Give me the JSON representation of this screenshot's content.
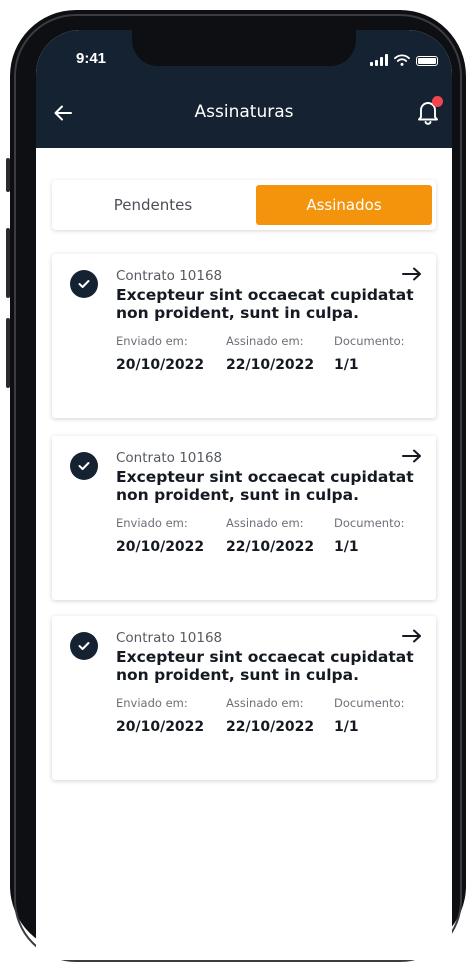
{
  "status_bar": {
    "time": "9:41"
  },
  "header": {
    "title": "Assinaturas",
    "back_icon": "arrow-left-icon",
    "notification_icon": "bell-icon"
  },
  "tabs": [
    {
      "label": "Pendentes",
      "active": false
    },
    {
      "label": "Assinados",
      "active": true
    }
  ],
  "colors": {
    "header_bg": "#152231",
    "accent": "#f4940d",
    "notification_dot": "#f2454d"
  },
  "labels": {
    "sent": "Enviado em:",
    "signed": "Assinado em:",
    "document": "Documento:"
  },
  "contracts": [
    {
      "number": "Contrato 10168",
      "title": "Excepteur sint occaecat cupidatat non proident, sunt in culpa.",
      "sent_date": "20/10/2022",
      "signed_date": "22/10/2022",
      "document": "1/1"
    },
    {
      "number": "Contrato 10168",
      "title": "Excepteur sint occaecat cupidatat non proident, sunt in culpa.",
      "sent_date": "20/10/2022",
      "signed_date": "22/10/2022",
      "document": "1/1"
    },
    {
      "number": "Contrato 10168",
      "title": "Excepteur sint occaecat cupidatat non proident, sunt in culpa.",
      "sent_date": "20/10/2022",
      "signed_date": "22/10/2022",
      "document": "1/1"
    }
  ]
}
